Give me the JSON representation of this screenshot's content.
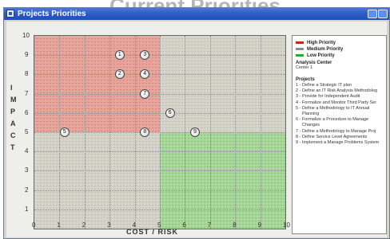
{
  "banner": {
    "text": "Current Priorities"
  },
  "window": {
    "title": "Projects Priorities"
  },
  "chart": {
    "xlabel": "COST / RISK",
    "ylabel": "IMPACT"
  },
  "chart_data": {
    "type": "scatter",
    "xlabel": "COST / RISK",
    "ylabel": "IMPACT",
    "xlim": [
      0,
      10
    ],
    "ylim": [
      0,
      10
    ],
    "x_ticks": [
      "0",
      "1",
      "2",
      "3",
      "4",
      "5",
      "6",
      "7",
      "8",
      "9",
      "10"
    ],
    "y_ticks": [
      "1",
      "2",
      "3",
      "4",
      "5",
      "6",
      "7",
      "8",
      "9",
      "10"
    ],
    "regions": [
      {
        "name": "High Priority",
        "x": [
          0,
          5
        ],
        "y": [
          5,
          10
        ],
        "color": "#e6a59b"
      },
      {
        "name": "Medium Priority",
        "x": [
          5,
          10
        ],
        "y": [
          5,
          10
        ],
        "color": "#d6d3c9"
      },
      {
        "name": "Medium Priority",
        "x": [
          0,
          5
        ],
        "y": [
          0,
          5
        ],
        "color": "#d6d3c9"
      },
      {
        "name": "Low Priority",
        "x": [
          5,
          10
        ],
        "y": [
          0,
          5
        ],
        "color": "#a9d99a"
      }
    ],
    "points": [
      {
        "label": "1",
        "x": 3.4,
        "y": 9.0
      },
      {
        "label": "2",
        "x": 3.4,
        "y": 8.0
      },
      {
        "label": "3",
        "x": 4.4,
        "y": 9.0
      },
      {
        "label": "4",
        "x": 4.4,
        "y": 8.0
      },
      {
        "label": "5",
        "x": 1.2,
        "y": 5.0
      },
      {
        "label": "6",
        "x": 5.4,
        "y": 6.0
      },
      {
        "label": "7",
        "x": 4.4,
        "y": 7.0
      },
      {
        "label": "8",
        "x": 4.4,
        "y": 5.0
      },
      {
        "label": "9",
        "x": 6.4,
        "y": 5.0
      }
    ]
  },
  "legend": {
    "high": {
      "label": "High Priority",
      "color": "#c0281f"
    },
    "medium": {
      "label": "Medium Priority",
      "color": "#8c8c8c"
    },
    "low": {
      "label": "Low Priority",
      "color": "#2ea52e"
    },
    "analysis_label": "Analysis Center",
    "analysis_value": "Center 1",
    "projects_label": "Projects",
    "projects": [
      "1 - Define a Strategic IT plan",
      "2 - Define an IT Risk Analysis Methodolog",
      "3 - Provide for Independent Audit",
      "4 - Formalize and Monitor Third Party Ser",
      "5 - Define a Methodology to IT Annual",
      "Planning",
      "6 - Formalize a Procedure to Manage",
      "Changes",
      "7 - Define a Methodology to Manage Proj",
      "8 - Define Service Level Agreements",
      "9 - Implement a Manage Problems System"
    ]
  }
}
